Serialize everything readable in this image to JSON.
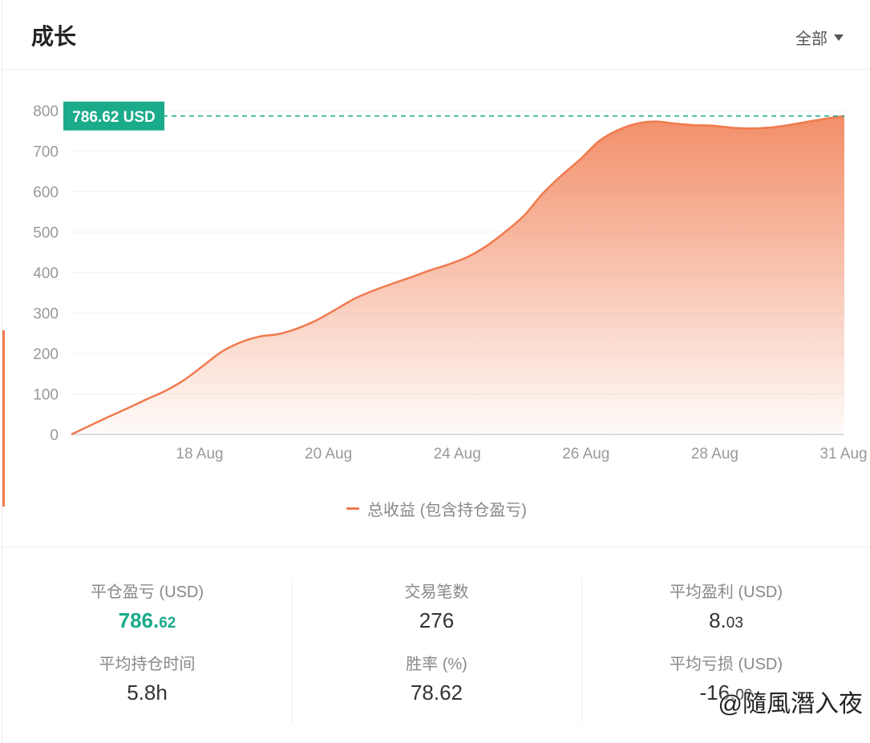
{
  "header": {
    "title": "成长",
    "filter_label": "全部"
  },
  "chart_data": {
    "type": "area",
    "title": "",
    "xlabel": "",
    "ylabel": "",
    "ylim": [
      0,
      800
    ],
    "yticks": [
      0,
      100,
      200,
      300,
      400,
      500,
      600,
      700,
      800
    ],
    "xticks": [
      "18 Aug",
      "20 Aug",
      "24 Aug",
      "26 Aug",
      "28 Aug",
      "31 Aug"
    ],
    "grid": true,
    "legend_position": "bottom-center",
    "current_value_label": "786.62 USD",
    "current_value": 786.62,
    "color": "#f07a4e",
    "label_color": "#1aab8b",
    "series": [
      {
        "name": "总收益 (包含持仓盈亏)",
        "points": [
          [
            0,
            0
          ],
          [
            0.5,
            22
          ],
          [
            1.0,
            44
          ],
          [
            1.5,
            65
          ],
          [
            2.0,
            87
          ],
          [
            2.5,
            108
          ],
          [
            3.0,
            135
          ],
          [
            3.5,
            170
          ],
          [
            4.0,
            205
          ],
          [
            4.5,
            228
          ],
          [
            5.0,
            242
          ],
          [
            5.5,
            248
          ],
          [
            6.0,
            262
          ],
          [
            6.5,
            282
          ],
          [
            7.0,
            308
          ],
          [
            7.5,
            335
          ],
          [
            8.0,
            355
          ],
          [
            8.5,
            372
          ],
          [
            9.0,
            388
          ],
          [
            9.5,
            405
          ],
          [
            10.0,
            420
          ],
          [
            10.5,
            438
          ],
          [
            11.0,
            465
          ],
          [
            11.5,
            500
          ],
          [
            12.0,
            540
          ],
          [
            12.5,
            595
          ],
          [
            13.0,
            640
          ],
          [
            13.5,
            680
          ],
          [
            14.0,
            725
          ],
          [
            14.5,
            752
          ],
          [
            15.0,
            768
          ],
          [
            15.5,
            773
          ],
          [
            16.0,
            768
          ],
          [
            16.5,
            764
          ],
          [
            17.0,
            763
          ],
          [
            17.5,
            758
          ],
          [
            18.0,
            756
          ],
          [
            18.5,
            758
          ],
          [
            19.0,
            764
          ],
          [
            19.5,
            772
          ],
          [
            20.0,
            780
          ],
          [
            20.5,
            786.62
          ]
        ]
      }
    ]
  },
  "stats": [
    {
      "items": [
        {
          "label": "平仓盈亏 (USD)",
          "value_int": "786.",
          "value_dec": "62",
          "color": "#1aab8b"
        },
        {
          "label": "平均持仓时间",
          "value_int": "5.8h",
          "value_dec": ""
        }
      ]
    },
    {
      "items": [
        {
          "label": "交易笔数",
          "value_int": "276",
          "value_dec": ""
        },
        {
          "label": "胜率 (%)",
          "value_int": "78.62",
          "value_dec": ""
        }
      ]
    },
    {
      "items": [
        {
          "label": "平均盈利 (USD)",
          "value_int": "8.",
          "value_dec": "03"
        },
        {
          "label": "平均亏损 (USD)",
          "value_int": "-16.",
          "value_dec": "02"
        }
      ]
    }
  ],
  "watermark": "@隨風潛入夜"
}
